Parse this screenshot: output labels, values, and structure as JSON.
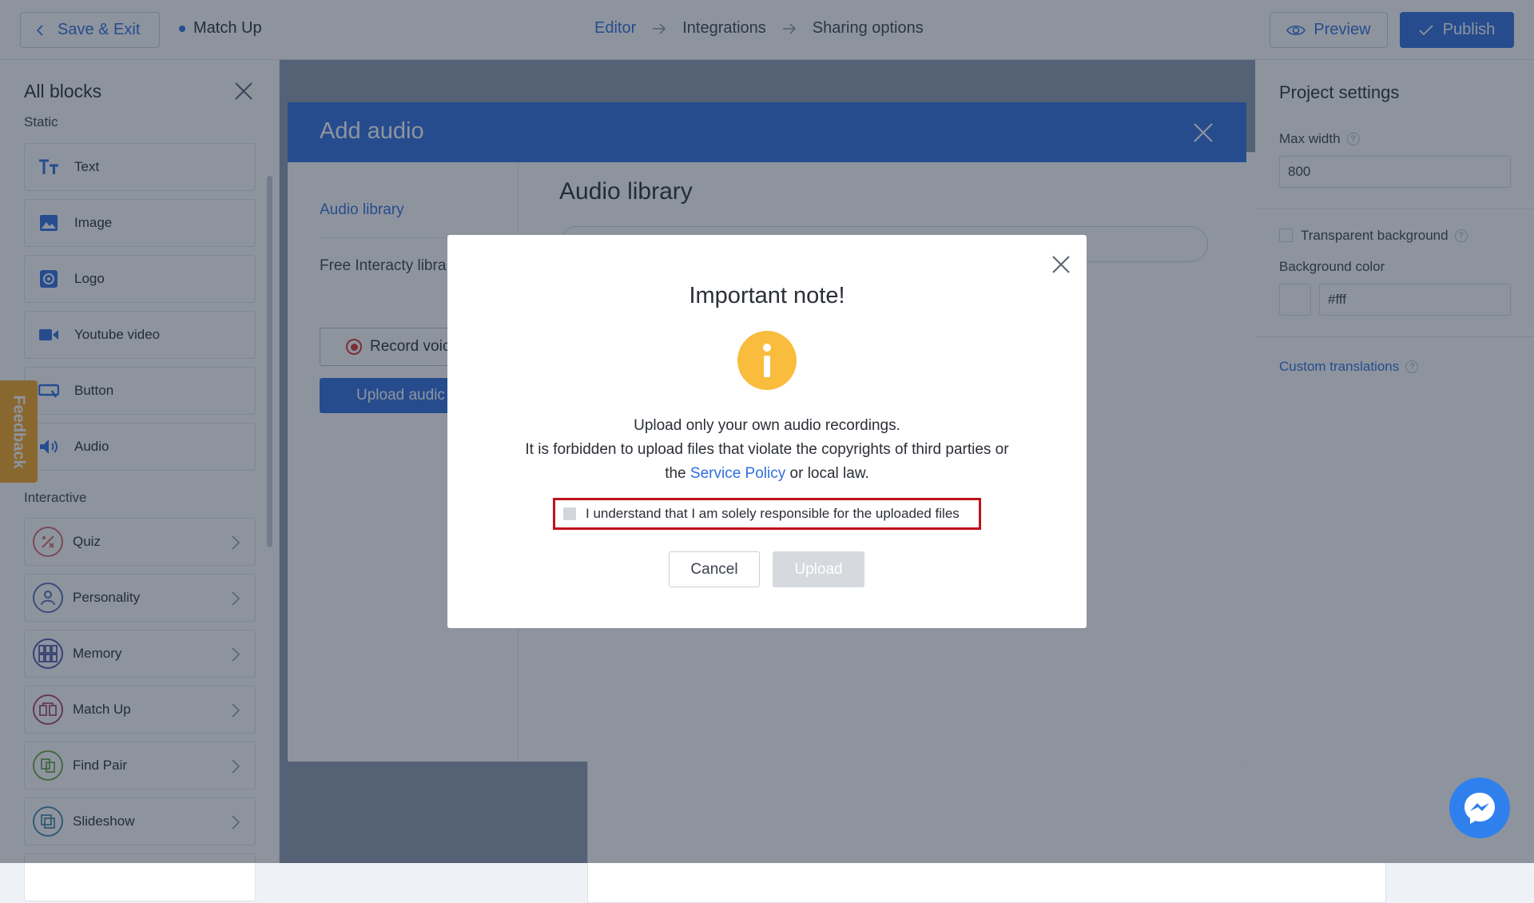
{
  "topbar": {
    "save_exit_label": "Save & Exit",
    "project_name": "Match Up",
    "steps": [
      "Editor",
      "Integrations",
      "Sharing options"
    ],
    "preview_label": "Preview",
    "publish_label": "Publish"
  },
  "sidebar": {
    "title": "All blocks",
    "static_label": "Static",
    "static_items": [
      "Text",
      "Image",
      "Logo",
      "Youtube video",
      "Button",
      "Audio"
    ],
    "interactive_label": "Interactive",
    "interactive_items": [
      "Quiz",
      "Personality",
      "Memory",
      "Match Up",
      "Find Pair",
      "Slideshow"
    ]
  },
  "feedback_label": "Feedback",
  "settings": {
    "title": "Project settings",
    "max_width_label": "Max width",
    "max_width_value": "800",
    "transparent_bg_label": "Transparent background",
    "bg_color_label": "Background color",
    "bg_color_value": "#fff",
    "custom_translations_label": "Custom translations"
  },
  "audio_modal": {
    "title": "Add audio",
    "nav": [
      "Audio library",
      "Free Interacty libra"
    ],
    "record_label": "Record voic",
    "upload_label": "Upload audic",
    "library_title": "Audio library"
  },
  "note": {
    "title": "Important note!",
    "line1": "Upload only your own audio recordings.",
    "line2": "It is forbidden to upload files that violate the copyrights of third parties or",
    "line3_pre": "the",
    "line3_link": "Service Policy",
    "line3_post": "or local law.",
    "checkbox_label": "I understand that I am solely responsible for the uploaded files",
    "cancel_label": "Cancel",
    "upload_label": "Upload"
  },
  "colors": {
    "accent": "#2f6fde",
    "warning": "#f9bc3c",
    "feedback": "#f5a623",
    "highlight_border": "#c0121c"
  }
}
